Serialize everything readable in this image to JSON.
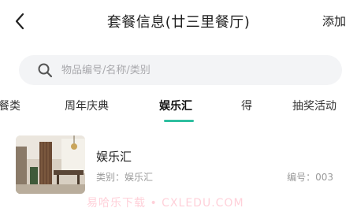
{
  "header": {
    "title": "套餐信息(廿三里餐厅)",
    "action_label": "添加"
  },
  "search": {
    "placeholder": "物品编号/名称/类别",
    "value": ""
  },
  "tabs": [
    {
      "label": "餐类",
      "active": false
    },
    {
      "label": "周年庆典",
      "active": false
    },
    {
      "label": "娱乐汇",
      "active": true
    },
    {
      "label": "得",
      "active": false
    },
    {
      "label": "抽奖活动",
      "active": false
    }
  ],
  "items": [
    {
      "name": "娱乐汇",
      "category_label": "类别：",
      "category": "娱乐汇",
      "code_label": "编号：",
      "code": "003"
    }
  ],
  "watermark": "易哈乐下载 • CXLEDU.COM",
  "colors": {
    "accent": "#2fbfa0",
    "search_bg": "#f3f4f6",
    "muted_text": "#9a9a9a"
  },
  "icons": {
    "back": "chevron-left-icon",
    "search": "search-icon"
  }
}
